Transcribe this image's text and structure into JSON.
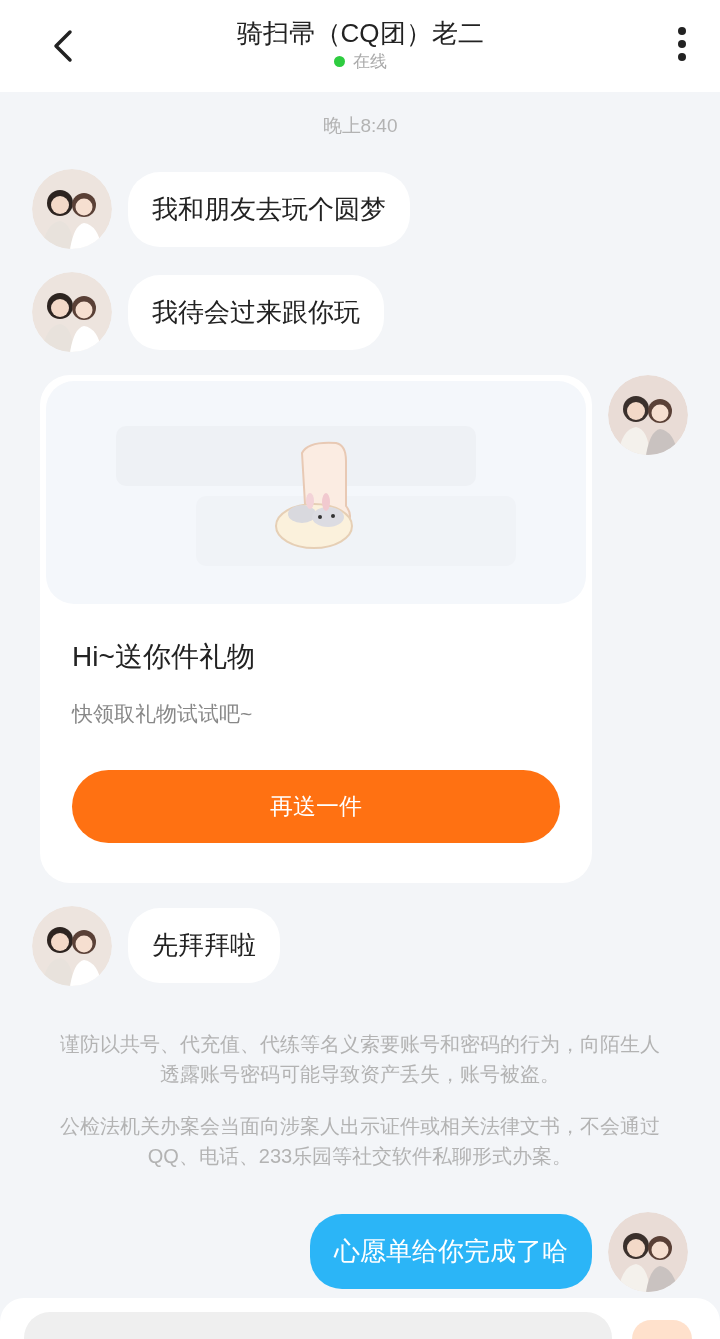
{
  "header": {
    "title": "骑扫帚（CQ团）老二",
    "status": "在线",
    "online": true
  },
  "messages": [
    {
      "kind": "time",
      "text": "晚上8:40"
    },
    {
      "kind": "text",
      "outgoing": false,
      "text": "我和朋友去玩个圆梦"
    },
    {
      "kind": "text",
      "outgoing": false,
      "text": "我待会过来跟你玩"
    },
    {
      "kind": "gift",
      "title": "Hi~送你件礼物",
      "subtitle": "快领取礼物试试吧~",
      "button": "再送一件"
    },
    {
      "kind": "text",
      "outgoing": false,
      "text": "先拜拜啦"
    },
    {
      "kind": "notice",
      "paragraphs": [
        "谨防以共号、代充值、代练等名义索要账号和密码的行为，向陌生人透露账号密码可能导致资产丢失，账号被盗。",
        "公检法机关办案会当面向涉案人出示证件或相关法律文书，不会通过QQ、电话、233乐园等社交软件私聊形式办案。"
      ]
    },
    {
      "kind": "text",
      "outgoing": true,
      "text": "心愿单给你完成了哈"
    }
  ]
}
